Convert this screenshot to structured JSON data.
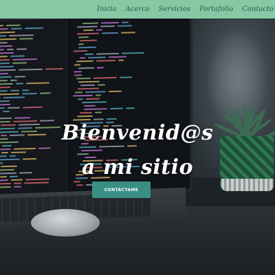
{
  "nav": {
    "items": [
      {
        "label": "Inicio"
      },
      {
        "label": "Acerca"
      },
      {
        "label": "Servicios"
      },
      {
        "label": "Portafolio"
      },
      {
        "label": "Contacto"
      }
    ]
  },
  "hero": {
    "title_line_1": "Bienvenid@s",
    "title_line_2": "a mi sitio",
    "cta_label": "CONTÁCTAME"
  },
  "colors": {
    "navbar_bg": "#86c9a4",
    "nav_text": "#2d5a49",
    "cta_bg": "#3a8f83",
    "title_text": "#ffffff"
  }
}
